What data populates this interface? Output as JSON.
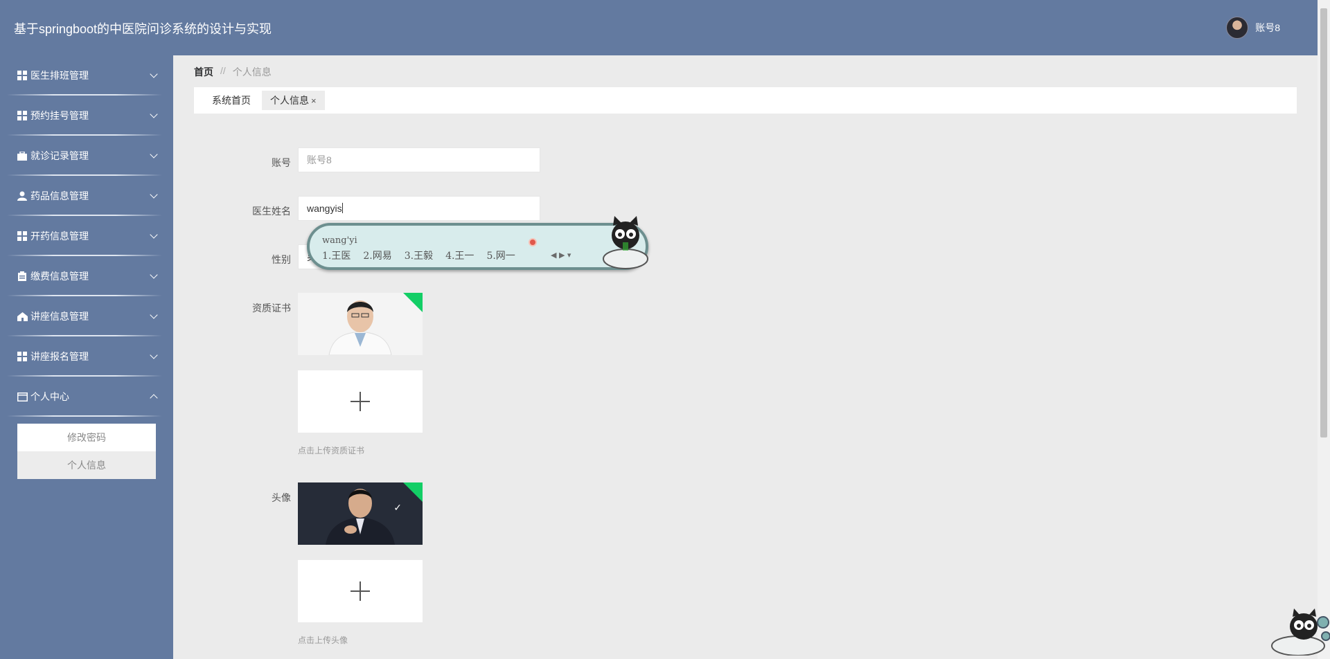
{
  "header": {
    "title": "基于springboot的中医院问诊系统的设计与实现",
    "username": "账号8"
  },
  "sidebar": {
    "items": [
      {
        "label": "医生排班管理",
        "icon": "grid-icon",
        "expanded": false
      },
      {
        "label": "预约挂号管理",
        "icon": "grid-icon",
        "expanded": false
      },
      {
        "label": "就诊记录管理",
        "icon": "briefcase-icon",
        "expanded": false
      },
      {
        "label": "药品信息管理",
        "icon": "user-icon",
        "expanded": false
      },
      {
        "label": "开药信息管理",
        "icon": "grid-icon",
        "expanded": false
      },
      {
        "label": "缴费信息管理",
        "icon": "clipboard-icon",
        "expanded": false
      },
      {
        "label": "讲座信息管理",
        "icon": "house-icon",
        "expanded": false
      },
      {
        "label": "讲座报名管理",
        "icon": "grid-icon",
        "expanded": false
      },
      {
        "label": "个人中心",
        "icon": "window-icon",
        "expanded": true
      }
    ],
    "submenu": [
      {
        "label": "修改密码",
        "active": false
      },
      {
        "label": "个人信息",
        "active": true
      }
    ]
  },
  "breadcrumb": {
    "home": "首页",
    "separator": "//",
    "current": "个人信息"
  },
  "tabs": [
    {
      "label": "系统首页",
      "active": false,
      "closable": false
    },
    {
      "label": "个人信息",
      "active": true,
      "closable": true,
      "close_symbol": "×"
    }
  ],
  "form": {
    "account": {
      "label": "账号",
      "value": "账号8"
    },
    "doctor_name": {
      "label": "医生姓名",
      "value": "wangyis"
    },
    "gender": {
      "label": "性别",
      "value": "男"
    },
    "certificate": {
      "label": "资质证书",
      "tip": "点击上传资质证书"
    },
    "avatar": {
      "label": "头像",
      "tip": "点击上传头像"
    }
  },
  "ime": {
    "pinyin": "wang'yi",
    "candidates": [
      "1.王医",
      "2.网易",
      "3.王毅",
      "4.王一",
      "5.网一"
    ]
  },
  "colors": {
    "primary": "#637aa0",
    "background": "#ebebeb",
    "upload_success": "#13ce66"
  }
}
